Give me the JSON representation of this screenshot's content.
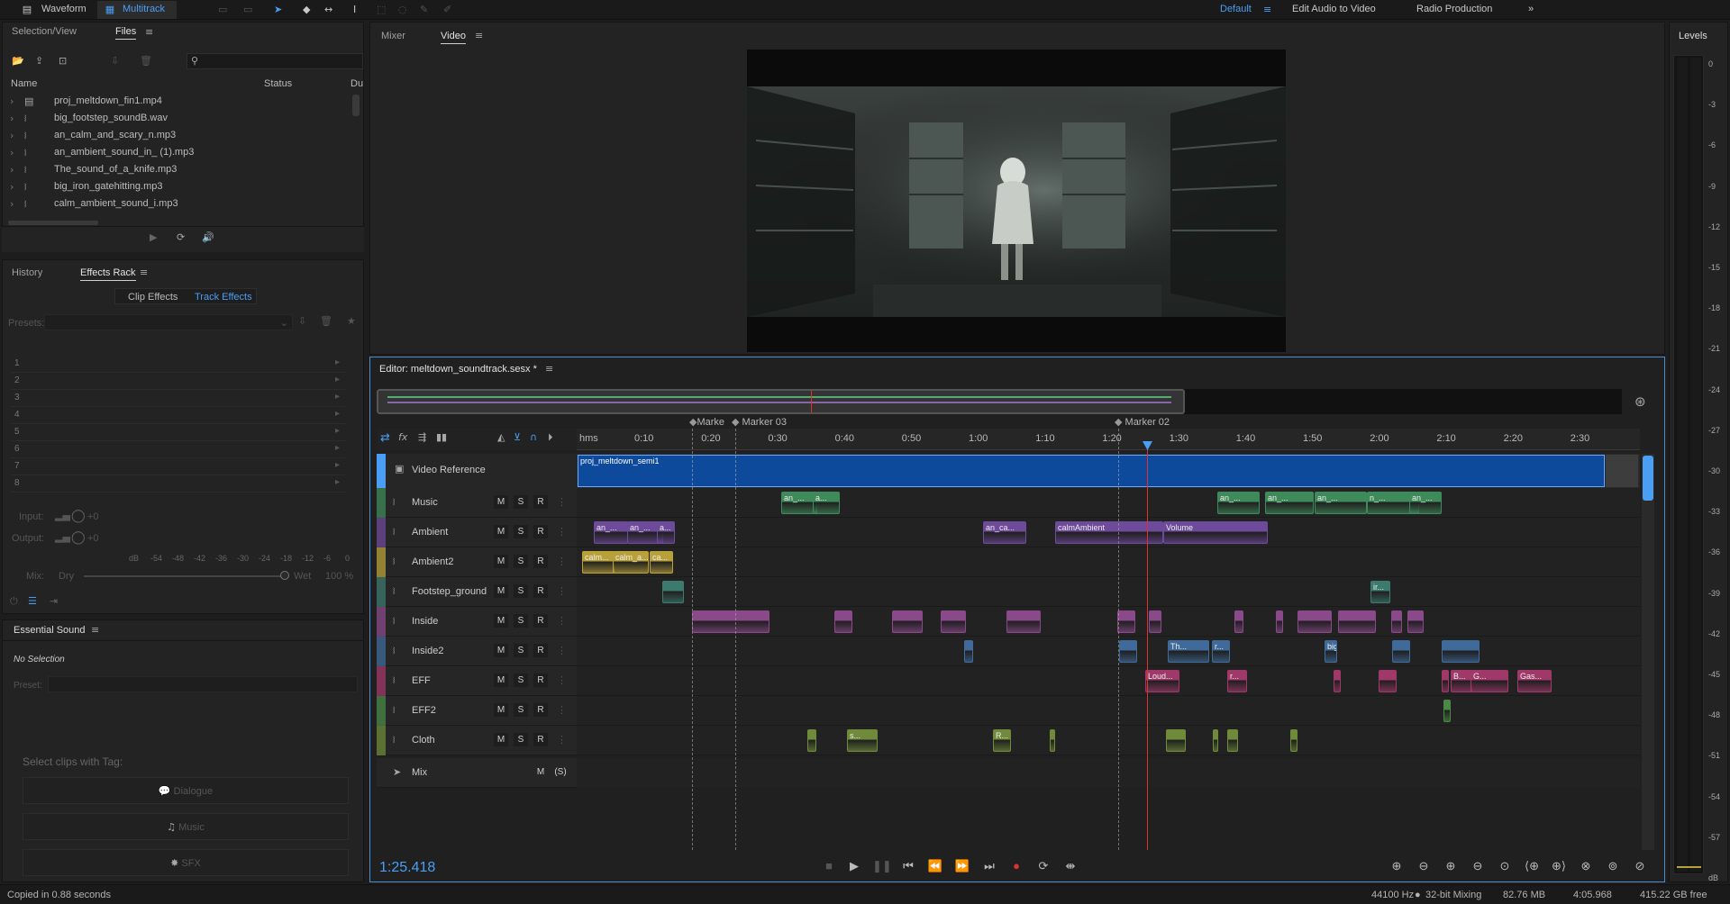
{
  "topbar": {
    "waveform": "Waveform",
    "multitrack": "Multitrack",
    "workspaces": [
      "Default",
      "Edit Audio to Video",
      "Radio Production"
    ],
    "more": "»"
  },
  "files_panel": {
    "tabs": [
      "Selection/View",
      "Files"
    ],
    "columns": [
      "Name",
      "Status",
      "Du"
    ],
    "files": [
      "proj_meltdown_fin1.mp4",
      "big_footstep_soundB.wav",
      "an_calm_and_scary_n.mp3",
      "an_ambient_sound_in_ (1).mp3",
      "The_sound_of_a_knife.mp3",
      "big_iron_gatehitting.mp3",
      "calm_ambient_sound_i.mp3"
    ]
  },
  "effects_panel": {
    "tabs": [
      "History",
      "Effects Rack"
    ],
    "sub_tabs": [
      "Clip Effects",
      "Track Effects"
    ],
    "presets_label": "Presets:",
    "slots": [
      "1",
      "2",
      "3",
      "4",
      "5",
      "6",
      "7",
      "8"
    ],
    "input_label": "Input:",
    "input_value": "+0",
    "output_label": "Output:",
    "output_value": "+0",
    "db_scale": [
      "dB",
      "-54",
      "-48",
      "-42",
      "-36",
      "-30",
      "-24",
      "-18",
      "-12",
      "-6",
      "0"
    ],
    "mix_label": "Mix:",
    "dry_label": "Dry",
    "wet_label": "Wet",
    "wet_value": "100 %"
  },
  "essential_sound": {
    "title": "Essential Sound",
    "no_selection": "No Selection",
    "preset_label": "Preset:",
    "tag_prompt": "Select clips with Tag:",
    "tags": [
      "Dialogue",
      "Music",
      "SFX"
    ]
  },
  "status_bar": {
    "left": "Copied in 0.88 seconds",
    "sample_rate": "44100 Hz",
    "bit_depth": "32-bit Mixing",
    "memory": "82.76 MB",
    "duration": "4:05.968",
    "free_space": "415.22 GB free"
  },
  "video_panel": {
    "tabs": [
      "Mixer",
      "Video"
    ]
  },
  "editor": {
    "title": "Editor: meltdown_soundtrack.sesx *",
    "timecode": "1:25.418",
    "ruler_unit": "hms",
    "ruler_labels": [
      "0:10",
      "0:20",
      "0:30",
      "0:40",
      "0:50",
      "1:00",
      "1:10",
      "1:20",
      "1:30",
      "1:40",
      "1:50",
      "2:00",
      "2:10",
      "2:20",
      "2:30"
    ],
    "markers": [
      "Marke",
      "Marker 03",
      "Marker 02"
    ],
    "video_track": {
      "name": "Video Reference",
      "clip": "proj_meltdown_semi1"
    },
    "tracks": [
      {
        "name": "Music",
        "color": "#3f8a5a"
      },
      {
        "name": "Ambient",
        "color": "#6d4a9a"
      },
      {
        "name": "Ambient2",
        "color": "#b9a13a"
      },
      {
        "name": "Footstep_ground",
        "color": "#3c7a6e"
      },
      {
        "name": "Inside",
        "color": "#8a4a8a"
      },
      {
        "name": "Inside2",
        "color": "#3f6a9a"
      },
      {
        "name": "EFF",
        "color": "#a0386a"
      },
      {
        "name": "EFF2",
        "color": "#4a8a46"
      },
      {
        "name": "Cloth",
        "color": "#6f8a3a"
      }
    ],
    "mix_track": "Mix",
    "btn_m": "M",
    "btn_s": "S",
    "btn_r": "R",
    "btn_mix_s": "(S)",
    "clip_labels": {
      "music": [
        "an_...",
        "a...",
        "an_...",
        "an_...",
        "an_...",
        "n_...",
        "an_..."
      ],
      "ambient": [
        "an_...",
        "an_...",
        "a...",
        "an_ca...",
        "calmAmbient",
        "Volume",
        "calmAmbient",
        "Volume"
      ],
      "ambient2": [
        "calm...",
        "calm_a...",
        "ca..."
      ],
      "footstep": [
        "ir..."
      ],
      "inside2": [
        "Th...",
        "r...",
        "big..."
      ],
      "eff": [
        "Loud...",
        "r...",
        "B...",
        "G...",
        "Gas..."
      ],
      "cloth": [
        "s...",
        "R..."
      ]
    }
  },
  "levels_panel": {
    "title": "Levels",
    "ticks": [
      "0",
      "-3",
      "-6",
      "-9",
      "-12",
      "-15",
      "-18",
      "-21",
      "-24",
      "-27",
      "-30",
      "-33",
      "-36",
      "-39",
      "-42",
      "-45",
      "-48",
      "-51",
      "-54",
      "-57",
      "dB"
    ]
  },
  "colors": {
    "accent": "#4a9ff5",
    "video_clip": "#0d4a9c",
    "playhead": "#e03030"
  }
}
